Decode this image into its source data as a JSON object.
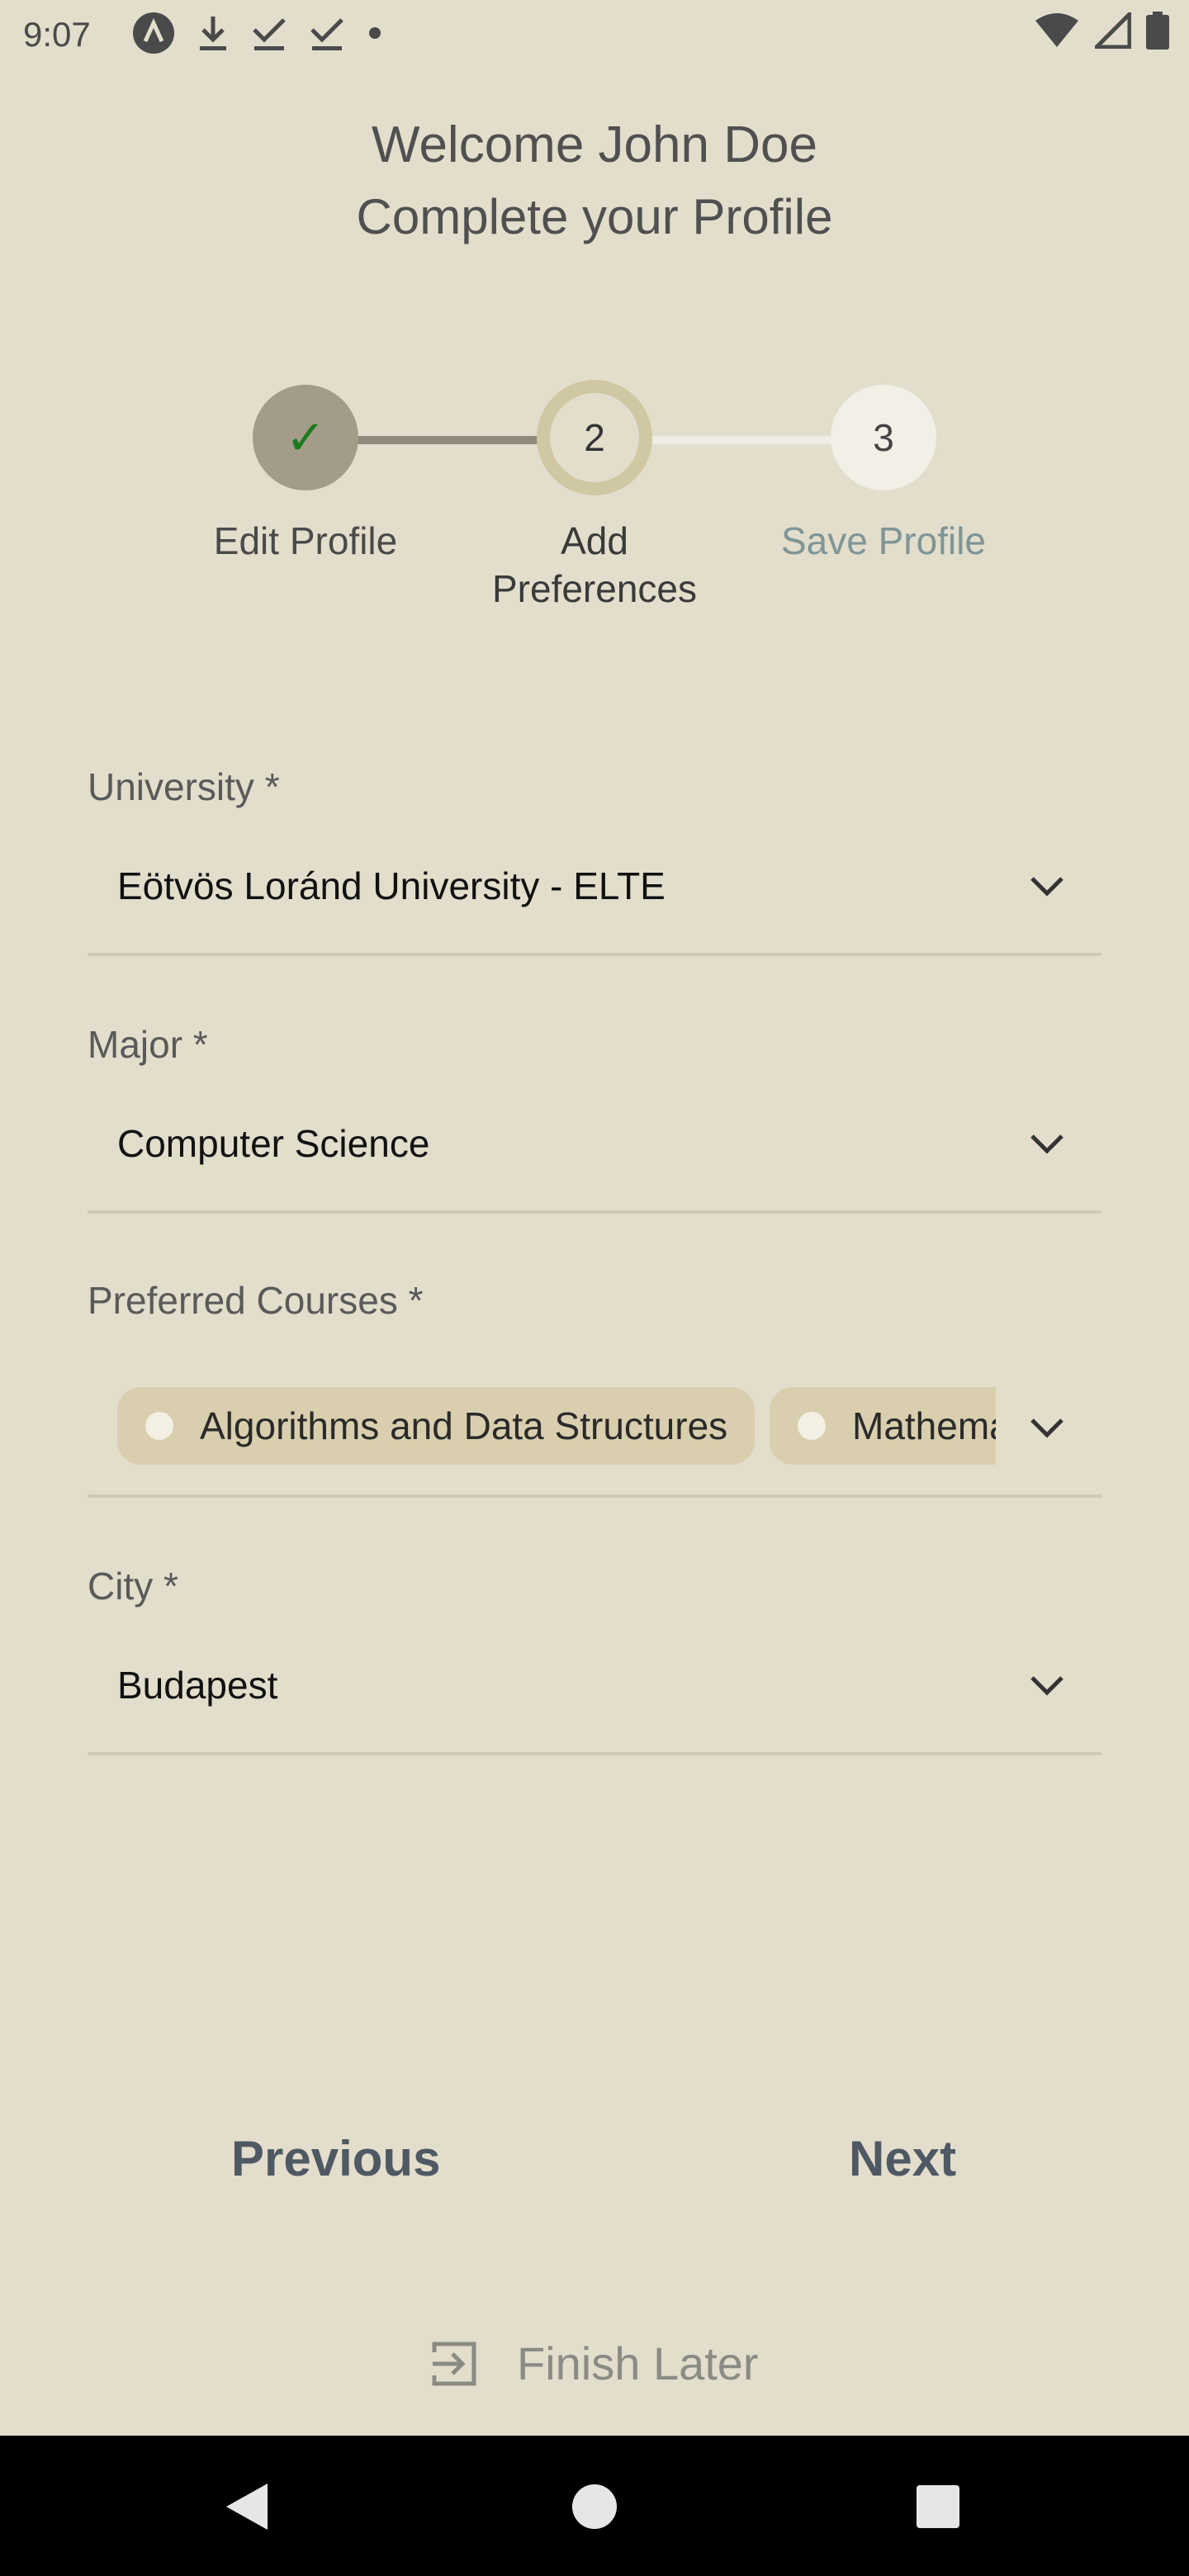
{
  "status_bar": {
    "time": "9:07",
    "left_icons": [
      "app-icon",
      "download-icon",
      "check-download-icon",
      "check-download-icon",
      "dot-icon"
    ],
    "right_icons": [
      "wifi-icon",
      "signal-icon",
      "battery-icon"
    ]
  },
  "header": {
    "welcome": "Welcome John Doe",
    "subtitle": "Complete your Profile"
  },
  "stepper": {
    "steps": [
      {
        "number": "✓",
        "label_line1": "Edit Profile",
        "label_line2": "",
        "state": "completed"
      },
      {
        "number": "2",
        "label_line1": "Add",
        "label_line2": "Preferences",
        "state": "active"
      },
      {
        "number": "3",
        "label_line1": "Save Profile",
        "label_line2": "",
        "state": "upcoming"
      }
    ]
  },
  "form": {
    "university": {
      "label": "University *",
      "value": "Eötvös Loránd University - ELTE"
    },
    "major": {
      "label": "Major *",
      "value": "Computer Science"
    },
    "courses": {
      "label": "Preferred Courses *",
      "chips": [
        "Algorithms and Data Structures",
        "Mathematics"
      ]
    },
    "city": {
      "label": "City *",
      "value": "Budapest"
    }
  },
  "buttons": {
    "previous": "Previous",
    "next": "Next",
    "finish_later": "Finish Later"
  },
  "colors": {
    "background": "#e3ddcc",
    "step_completed": "#a39c8a",
    "step_active_ring": "#d0c7a3",
    "step_upcoming": "#f2efe6",
    "check": "#1f7a1f"
  }
}
